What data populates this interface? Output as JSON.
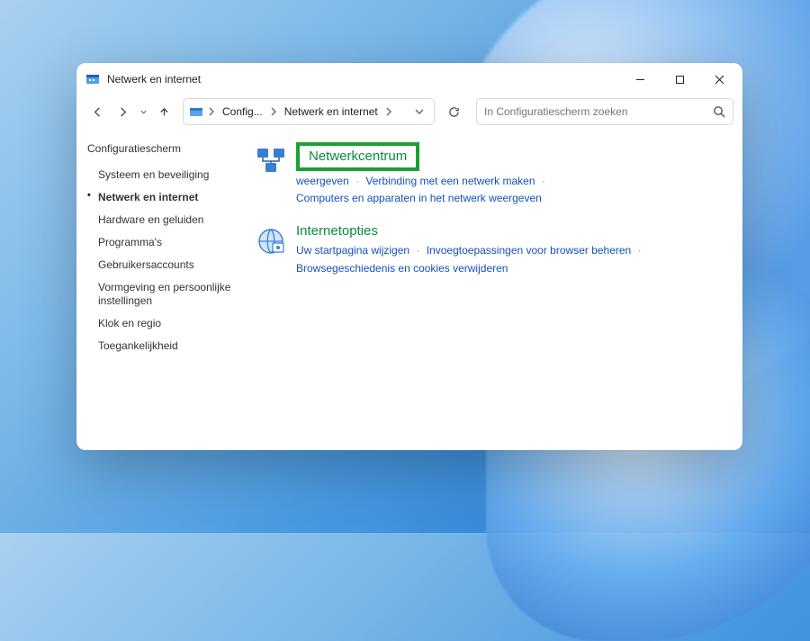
{
  "window": {
    "title": "Netwerk en internet"
  },
  "breadcrumb": {
    "item1": "Config...",
    "item2": "Netwerk en internet"
  },
  "search": {
    "placeholder": "In Configuratiescherm zoeken"
  },
  "sidebar": {
    "heading": "Configuratiescherm",
    "items": [
      "Systeem en beveiliging",
      "Netwerk en internet",
      "Hardware en geluiden",
      "Programma's",
      "Gebruikersaccounts",
      "Vormgeving en persoonlijke instellingen",
      "Klok en regio",
      "Toegankelijkheid"
    ],
    "current_index": 1
  },
  "sections": [
    {
      "title": "Netwerkcentrum",
      "links": [
        "Netwerkstatus en -taken weergeven",
        "Verbinding met een netwerk maken",
        "Computers en apparaten in het netwerk weergeven"
      ],
      "links_visible_trim": "weergeven",
      "highlighted": true,
      "icon": "network-sharing-icon"
    },
    {
      "title": "Internetopties",
      "links": [
        "Uw startpagina wijzigen",
        "Invoegtoepassingen voor browser beheren",
        "Browsegeschiedenis en cookies verwijderen"
      ],
      "highlighted": false,
      "icon": "internet-options-icon"
    }
  ],
  "colors": {
    "accent_green": "#0c8a3e",
    "link_blue": "#1451b8",
    "highlight": "#1aa132"
  }
}
